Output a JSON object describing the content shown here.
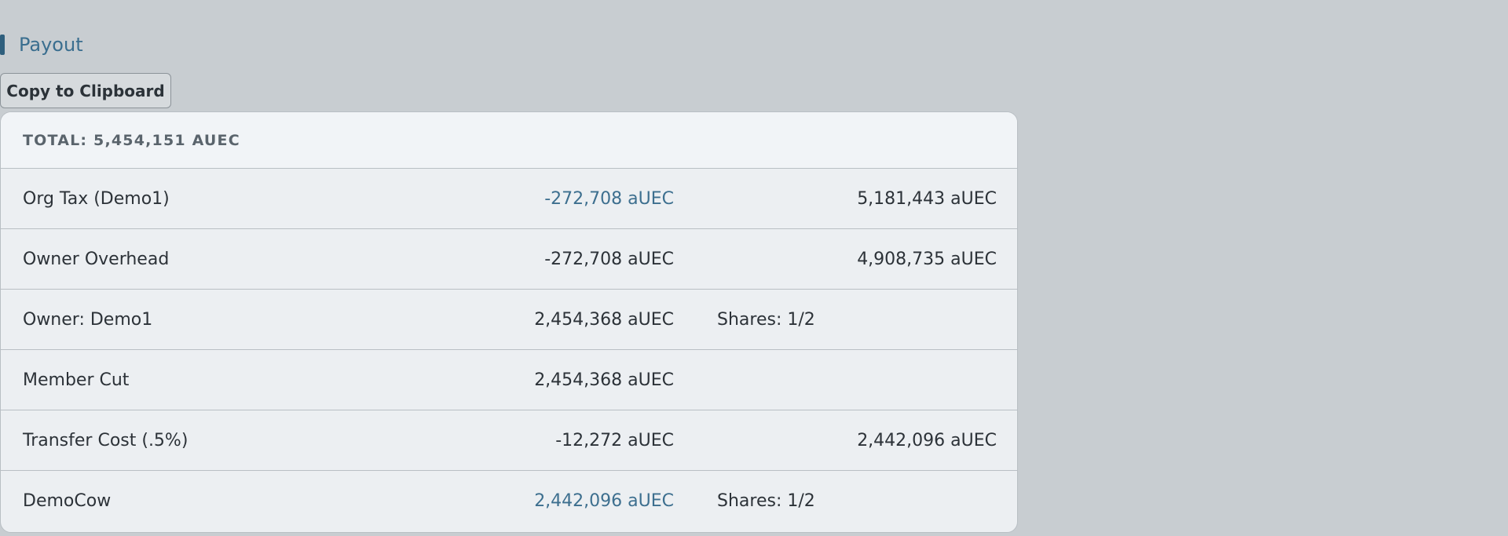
{
  "section": {
    "title": "Payout"
  },
  "toolbar": {
    "copy_label": "Copy to Clipboard"
  },
  "table": {
    "total": "TOTAL: 5,454,151 AUEC",
    "rows": [
      {
        "label": "Org Tax (Demo1)",
        "amount": "-272,708 aUEC",
        "amount_color": "#3d6f8f",
        "shares": "",
        "balance": "5,181,443 aUEC"
      },
      {
        "label": "Owner Overhead",
        "amount": "-272,708 aUEC",
        "amount_color": "#2c3238",
        "shares": "",
        "balance": "4,908,735 aUEC"
      },
      {
        "label": "Owner: Demo1",
        "amount": "2,454,368 aUEC",
        "amount_color": "#2c3238",
        "shares": "Shares: 1/2",
        "balance": ""
      },
      {
        "label": "Member Cut",
        "amount": "2,454,368 aUEC",
        "amount_color": "#2c3238",
        "shares": "",
        "balance": ""
      },
      {
        "label": "Transfer Cost (.5%)",
        "amount": "-12,272 aUEC",
        "amount_color": "#2c3238",
        "shares": "",
        "balance": "2,442,096 aUEC"
      },
      {
        "label": "DemoCow",
        "amount": "2,442,096 aUEC",
        "amount_color": "#3d6f8f",
        "shares": "Shares: 1/2",
        "balance": ""
      }
    ]
  }
}
